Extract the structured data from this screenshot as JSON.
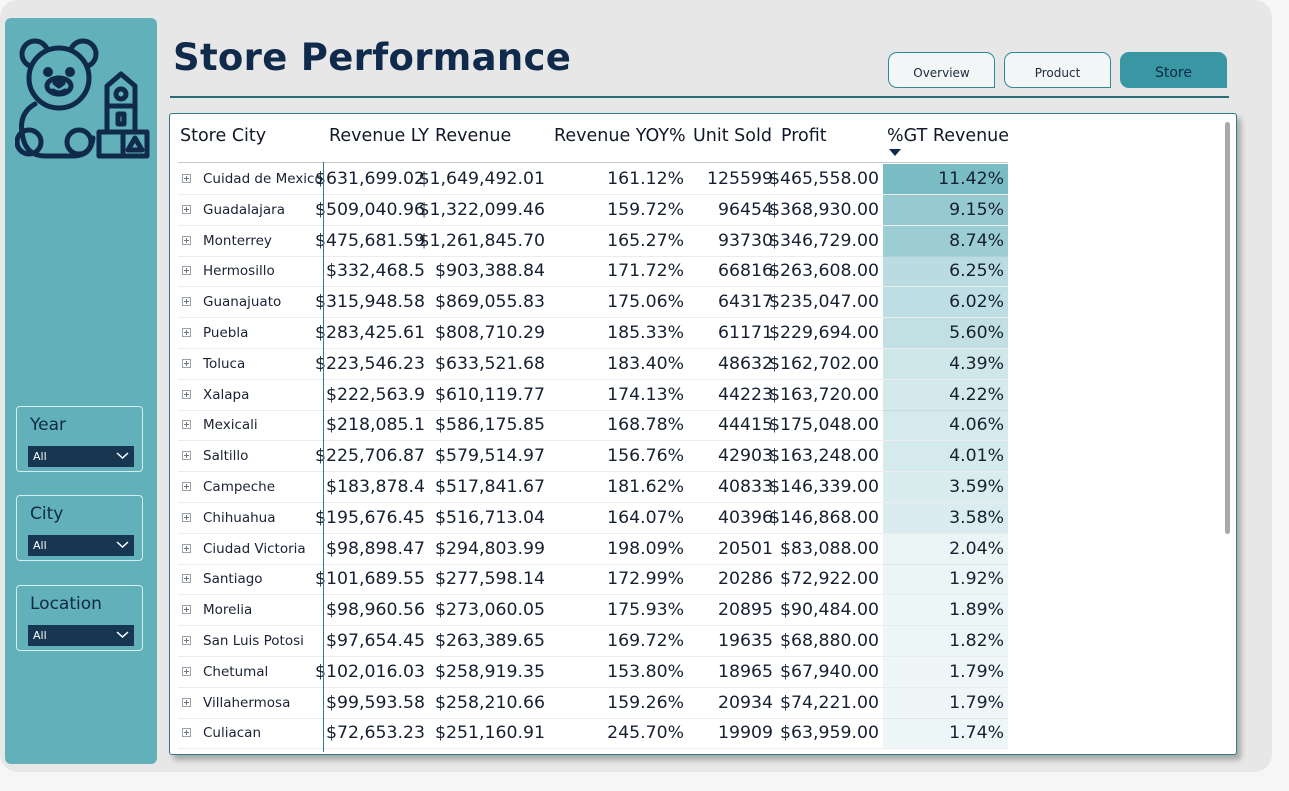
{
  "page": {
    "title": "Store Performance"
  },
  "nav": [
    {
      "label": "Overview",
      "active": false
    },
    {
      "label": "Product",
      "active": false
    },
    {
      "label": "Store",
      "active": true
    }
  ],
  "logo": {
    "icon": "teddy-bear-toy-blocks-icon"
  },
  "slicers": [
    {
      "label": "Year",
      "value": "All"
    },
    {
      "label": "City",
      "value": "All"
    },
    {
      "label": "Location",
      "value": "All"
    }
  ],
  "table": {
    "columns": [
      "Store City",
      "Revenue LY",
      "Revenue",
      "Revenue YOY%",
      "Unit Sold",
      "Profit",
      "%GT Revenue"
    ],
    "sorted_by": "%GT Revenue",
    "sort_direction": "descending",
    "heat_color": "#62b0b9",
    "rows": [
      {
        "city": "Cuidad de Mexico",
        "revenue_ly": "$631,699.02",
        "revenue": "$1,649,492.01",
        "yoy": "161.12%",
        "units": "125599",
        "profit": "$465,558.00",
        "gt": "11.42%",
        "gt_value": 11.42
      },
      {
        "city": "Guadalajara",
        "revenue_ly": "$509,040.96",
        "revenue": "$1,322,099.46",
        "yoy": "159.72%",
        "units": "96454",
        "profit": "$368,930.00",
        "gt": "9.15%",
        "gt_value": 9.15
      },
      {
        "city": "Monterrey",
        "revenue_ly": "$475,681.59",
        "revenue": "$1,261,845.70",
        "yoy": "165.27%",
        "units": "93730",
        "profit": "$346,729.00",
        "gt": "8.74%",
        "gt_value": 8.74
      },
      {
        "city": "Hermosillo",
        "revenue_ly": "$332,468.5",
        "revenue": "$903,388.84",
        "yoy": "171.72%",
        "units": "66816",
        "profit": "$263,608.00",
        "gt": "6.25%",
        "gt_value": 6.25
      },
      {
        "city": "Guanajuato",
        "revenue_ly": "$315,948.58",
        "revenue": "$869,055.83",
        "yoy": "175.06%",
        "units": "64317",
        "profit": "$235,047.00",
        "gt": "6.02%",
        "gt_value": 6.02
      },
      {
        "city": "Puebla",
        "revenue_ly": "$283,425.61",
        "revenue": "$808,710.29",
        "yoy": "185.33%",
        "units": "61171",
        "profit": "$229,694.00",
        "gt": "5.60%",
        "gt_value": 5.6
      },
      {
        "city": "Toluca",
        "revenue_ly": "$223,546.23",
        "revenue": "$633,521.68",
        "yoy": "183.40%",
        "units": "48632",
        "profit": "$162,702.00",
        "gt": "4.39%",
        "gt_value": 4.39
      },
      {
        "city": "Xalapa",
        "revenue_ly": "$222,563.9",
        "revenue": "$610,119.77",
        "yoy": "174.13%",
        "units": "44223",
        "profit": "$163,720.00",
        "gt": "4.22%",
        "gt_value": 4.22
      },
      {
        "city": "Mexicali",
        "revenue_ly": "$218,085.1",
        "revenue": "$586,175.85",
        "yoy": "168.78%",
        "units": "44415",
        "profit": "$175,048.00",
        "gt": "4.06%",
        "gt_value": 4.06
      },
      {
        "city": "Saltillo",
        "revenue_ly": "$225,706.87",
        "revenue": "$579,514.97",
        "yoy": "156.76%",
        "units": "42903",
        "profit": "$163,248.00",
        "gt": "4.01%",
        "gt_value": 4.01
      },
      {
        "city": "Campeche",
        "revenue_ly": "$183,878.4",
        "revenue": "$517,841.67",
        "yoy": "181.62%",
        "units": "40833",
        "profit": "$146,339.00",
        "gt": "3.59%",
        "gt_value": 3.59
      },
      {
        "city": "Chihuahua",
        "revenue_ly": "$195,676.45",
        "revenue": "$516,713.04",
        "yoy": "164.07%",
        "units": "40396",
        "profit": "$146,868.00",
        "gt": "3.58%",
        "gt_value": 3.58
      },
      {
        "city": "Ciudad Victoria",
        "revenue_ly": "$98,898.47",
        "revenue": "$294,803.99",
        "yoy": "198.09%",
        "units": "20501",
        "profit": "$83,088.00",
        "gt": "2.04%",
        "gt_value": 2.04
      },
      {
        "city": "Santiago",
        "revenue_ly": "$101,689.55",
        "revenue": "$277,598.14",
        "yoy": "172.99%",
        "units": "20286",
        "profit": "$72,922.00",
        "gt": "1.92%",
        "gt_value": 1.92
      },
      {
        "city": "Morelia",
        "revenue_ly": "$98,960.56",
        "revenue": "$273,060.05",
        "yoy": "175.93%",
        "units": "20895",
        "profit": "$90,484.00",
        "gt": "1.89%",
        "gt_value": 1.89
      },
      {
        "city": "San Luis Potosi",
        "revenue_ly": "$97,654.45",
        "revenue": "$263,389.65",
        "yoy": "169.72%",
        "units": "19635",
        "profit": "$68,880.00",
        "gt": "1.82%",
        "gt_value": 1.82
      },
      {
        "city": "Chetumal",
        "revenue_ly": "$102,016.03",
        "revenue": "$258,919.35",
        "yoy": "153.80%",
        "units": "18965",
        "profit": "$67,940.00",
        "gt": "1.79%",
        "gt_value": 1.79
      },
      {
        "city": "Villahermosa",
        "revenue_ly": "$99,593.58",
        "revenue": "$258,210.66",
        "yoy": "159.26%",
        "units": "20934",
        "profit": "$74,221.00",
        "gt": "1.79%",
        "gt_value": 1.79
      },
      {
        "city": "Culiacan",
        "revenue_ly": "$72,653.23",
        "revenue": "$251,160.91",
        "yoy": "245.70%",
        "units": "19909",
        "profit": "$63,959.00",
        "gt": "1.74%",
        "gt_value": 1.74
      }
    ]
  }
}
